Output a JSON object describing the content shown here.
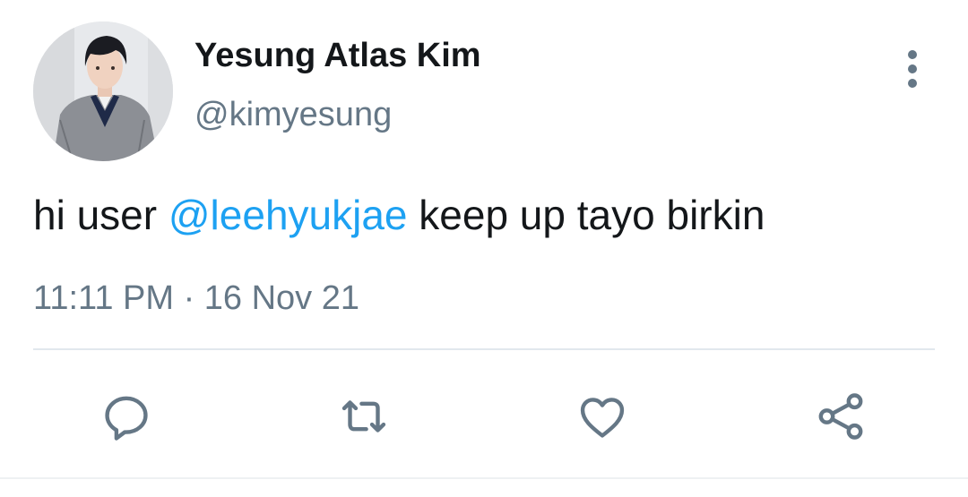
{
  "author": {
    "display_name": "Yesung Atlas Kim",
    "handle": "@kimyesung"
  },
  "tweet": {
    "text_before": "hi user ",
    "mention": "@leehyukjae",
    "text_after": " keep up tayo birkin",
    "timestamp": "11:11 PM · 16 Nov 21"
  },
  "icons": {
    "more": "more-vertical-icon",
    "reply": "reply-icon",
    "retweet": "retweet-icon",
    "like": "heart-icon",
    "share": "share-icon"
  },
  "colors": {
    "text": "#14171a",
    "secondary": "#657786",
    "mention": "#1da1f2",
    "divider": "#e1e8ed"
  }
}
